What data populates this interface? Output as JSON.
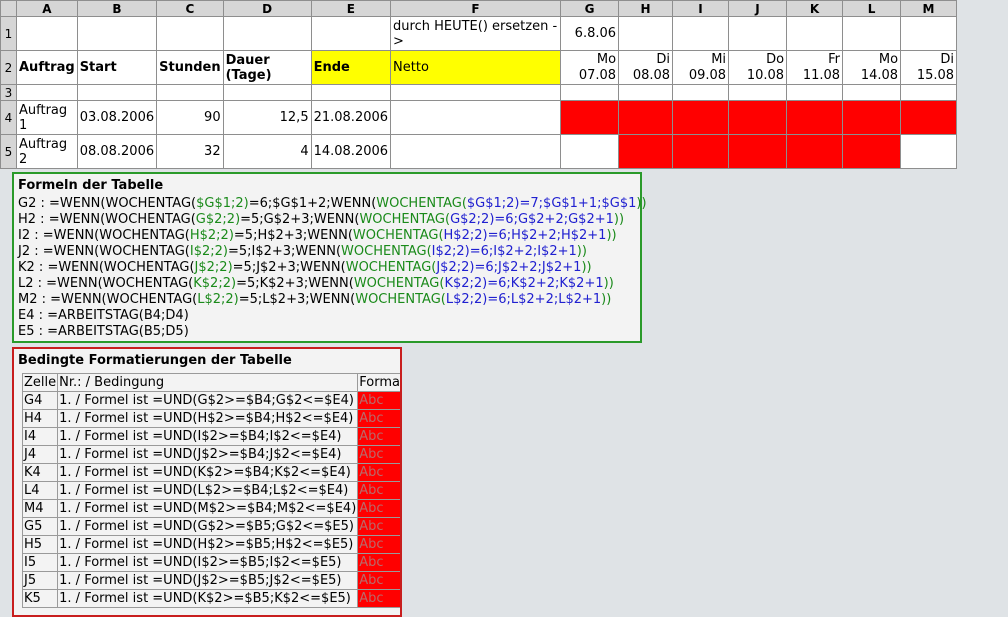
{
  "columns": [
    "A",
    "B",
    "C",
    "D",
    "E",
    "F",
    "G",
    "H",
    "I",
    "J",
    "K",
    "L",
    "M"
  ],
  "rows": [
    "1",
    "2",
    "3",
    "4",
    "5"
  ],
  "row1": {
    "F": "durch HEUTE() ersetzen ->",
    "G": "6.8.06"
  },
  "row2": {
    "A": "Auftrag",
    "B": "Start",
    "C": "Stunden",
    "D": "Dauer (Tage)",
    "E": "Ende",
    "F": "Netto",
    "dates": [
      {
        "day": "Mo",
        "date": "07.08"
      },
      {
        "day": "Di",
        "date": "08.08"
      },
      {
        "day": "Mi",
        "date": "09.08"
      },
      {
        "day": "Do",
        "date": "10.08"
      },
      {
        "day": "Fr",
        "date": "11.08"
      },
      {
        "day": "Mo",
        "date": "14.08"
      },
      {
        "day": "Di",
        "date": "15.08"
      }
    ]
  },
  "row4": {
    "A": "Auftrag 1",
    "B": "03.08.2006",
    "C": "90",
    "D": "12,5",
    "E": "21.08.2006"
  },
  "row5": {
    "A": "Auftrag 2",
    "B": "08.08.2006",
    "C": "32",
    "D": "4",
    "E": "14.08.2006"
  },
  "colors": {
    "highlight": "#ff0000",
    "yellow": "#ffff00",
    "formula_green": "#1a8a1a",
    "formula_blue": "#2020d0"
  },
  "formulas": {
    "title": "Formeln der Tabelle",
    "lines": [
      [
        "G2 : =WENN(WOCHENTAG(",
        "$G$1;2)",
        "=6;$G$1+2;WENN(",
        "WOCHENTAG(",
        "$G$1;2)=7;$G$1+1;$G$1",
        "))"
      ],
      [
        "H2 : =WENN(WOCHENTAG(",
        "G$2;2)",
        "=5;G$2+3;WENN(",
        "WOCHENTAG(",
        "G$2;2)=6;G$2+2;G$2+1",
        "))"
      ],
      [
        "I2 : =WENN(WOCHENTAG(",
        "H$2;2)",
        "=5;H$2+3;WENN(",
        "WOCHENTAG(",
        "H$2;2)=6;H$2+2;H$2+1",
        "))"
      ],
      [
        "J2 : =WENN(WOCHENTAG(",
        "I$2;2)",
        "=5;I$2+3;WENN(",
        "WOCHENTAG(",
        "I$2;2)=6;I$2+2;I$2+1",
        "))"
      ],
      [
        "K2 : =WENN(WOCHENTAG(",
        "J$2;2)",
        "=5;J$2+3;WENN(",
        "WOCHENTAG(",
        "J$2;2)=6;J$2+2;J$2+1",
        "))"
      ],
      [
        "L2 : =WENN(WOCHENTAG(",
        "K$2;2)",
        "=5;K$2+3;WENN(",
        "WOCHENTAG(",
        "K$2;2)=6;K$2+2;K$2+1",
        "))"
      ],
      [
        "M2 : =WENN(WOCHENTAG(",
        "L$2;2)",
        "=5;L$2+3;WENN(",
        "WOCHENTAG(",
        "L$2;2)=6;L$2+2;L$2+1",
        "))"
      ]
    ],
    "plain": [
      "E4 : =ARBEITSTAG(B4;D4)",
      "E5 : =ARBEITSTAG(B5;D5)"
    ]
  },
  "condfmt": {
    "title": "Bedingte Formatierungen der Tabelle",
    "headers": [
      "Zelle",
      "Nr.: / Bedingung",
      "Format"
    ],
    "rows": [
      [
        "G4",
        "1. / Formel ist =UND(G$2>=$B4;G$2<=$E4)",
        "Abc"
      ],
      [
        "H4",
        "1. / Formel ist =UND(H$2>=$B4;H$2<=$E4)",
        "Abc"
      ],
      [
        "I4",
        "1. / Formel ist =UND(I$2>=$B4;I$2<=$E4)",
        "Abc"
      ],
      [
        "J4",
        "1. / Formel ist =UND(J$2>=$B4;J$2<=$E4)",
        "Abc"
      ],
      [
        "K4",
        "1. / Formel ist =UND(K$2>=$B4;K$2<=$E4)",
        "Abc"
      ],
      [
        "L4",
        "1. / Formel ist =UND(L$2>=$B4;L$2<=$E4)",
        "Abc"
      ],
      [
        "M4",
        "1. / Formel ist =UND(M$2>=$B4;M$2<=$E4)",
        "Abc"
      ],
      [
        "G5",
        "1. / Formel ist =UND(G$2>=$B5;G$2<=$E5)",
        "Abc"
      ],
      [
        "H5",
        "1. / Formel ist =UND(H$2>=$B5;H$2<=$E5)",
        "Abc"
      ],
      [
        "I5",
        "1. / Formel ist =UND(I$2>=$B5;I$2<=$E5)",
        "Abc"
      ],
      [
        "J5",
        "1. / Formel ist =UND(J$2>=$B5;J$2<=$E5)",
        "Abc"
      ],
      [
        "K5",
        "1. / Formel ist =UND(K$2>=$B5;K$2<=$E5)",
        "Abc"
      ]
    ]
  }
}
